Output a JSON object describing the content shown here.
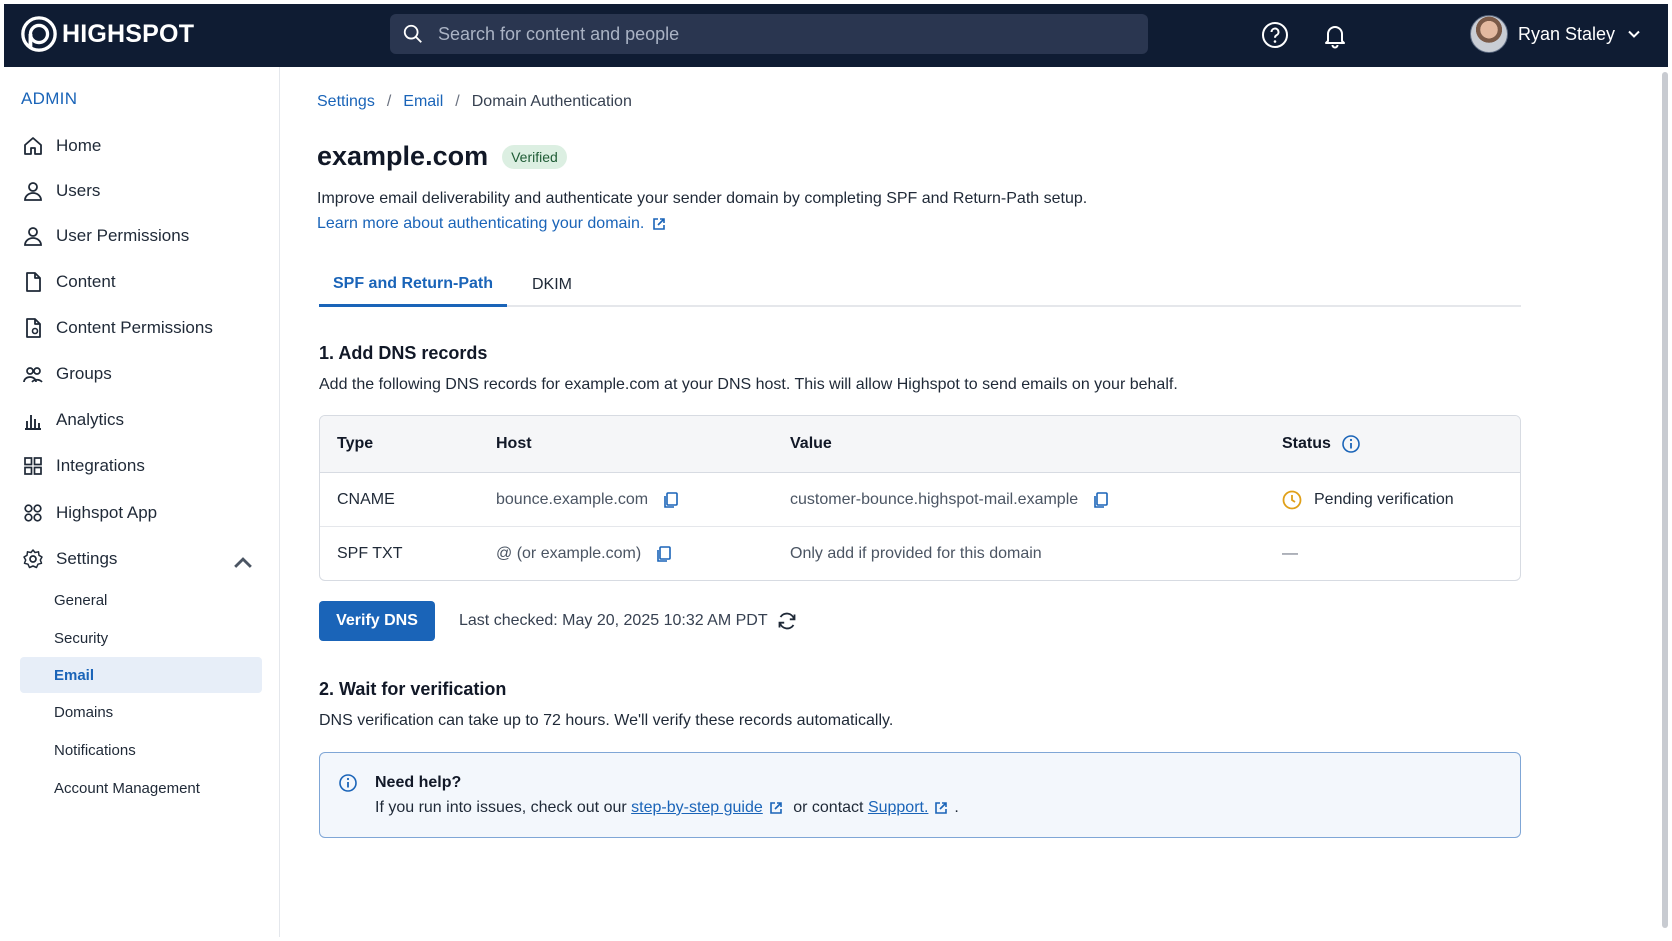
{
  "brand": {
    "name": "HIGHSPOT"
  },
  "search": {
    "placeholder": "Search for content and people"
  },
  "user": {
    "name": "Ryan Staley"
  },
  "sidebar": {
    "section_label": "ADMIN",
    "items": [
      {
        "label": "Home",
        "icon": "home-icon"
      },
      {
        "label": "Users",
        "icon": "user-icon"
      },
      {
        "label": "User Permissions",
        "icon": "user-permissions-icon"
      },
      {
        "label": "Content",
        "icon": "document-icon"
      },
      {
        "label": "Content Permissions",
        "icon": "content-permissions-icon"
      },
      {
        "label": "Groups",
        "icon": "groups-icon"
      },
      {
        "label": "Analytics",
        "icon": "analytics-icon"
      },
      {
        "label": "Integrations",
        "icon": "integrations-icon"
      },
      {
        "label": "Highspot App",
        "icon": "app-icon"
      },
      {
        "label": "Settings",
        "icon": "gear-icon"
      }
    ],
    "settings_sub": [
      "General",
      "Security",
      "Email",
      "Domains",
      "Notifications",
      "Account Management"
    ],
    "active_sub": "Email"
  },
  "breadcrumb": {
    "settings": "Settings",
    "email": "Email",
    "current": "Domain Authentication",
    "sep": "/"
  },
  "page": {
    "title": "example.com",
    "badge": "Verified",
    "description": "Improve email deliverability and authenticate your sender domain by completing SPF and Return-Path setup.",
    "learn_more": "Learn more about authenticating your domain."
  },
  "tabs": {
    "active": "SPF and Return-Path",
    "other": "DKIM"
  },
  "step1": {
    "title": "1. Add DNS records",
    "text": "Add the following DNS records for example.com at your DNS host. This will allow Highspot to send emails on your behalf."
  },
  "table": {
    "headers": {
      "type": "Type",
      "host": "Host",
      "value": "Value",
      "status": "Status"
    },
    "rows": [
      {
        "type": "CNAME",
        "host": "bounce.example.com",
        "value": "customer-bounce.highspot-mail.example",
        "status": "Pending verification"
      },
      {
        "type": "SPF TXT",
        "host": "@ (or example.com)",
        "value": "Only add if provided for this domain",
        "status": "—"
      }
    ]
  },
  "verify": {
    "button": "Verify DNS",
    "last_checked": "Last checked: May 20, 2025 10:32 AM PDT"
  },
  "step2": {
    "title": "2. Wait for verification",
    "text": "DNS verification can take up to 72 hours. We'll verify these records automatically."
  },
  "help": {
    "title": "Need help?",
    "prefix": "If you run into issues, check out our ",
    "guide": "step-by-step guide",
    "middle": " or contact ",
    "support": "Support.",
    "suffix": "."
  },
  "colors": {
    "accent": "#1a64b8",
    "topbar": "#0f1c33",
    "pending": "#e0a019",
    "verified_bg": "#dcefe2"
  }
}
